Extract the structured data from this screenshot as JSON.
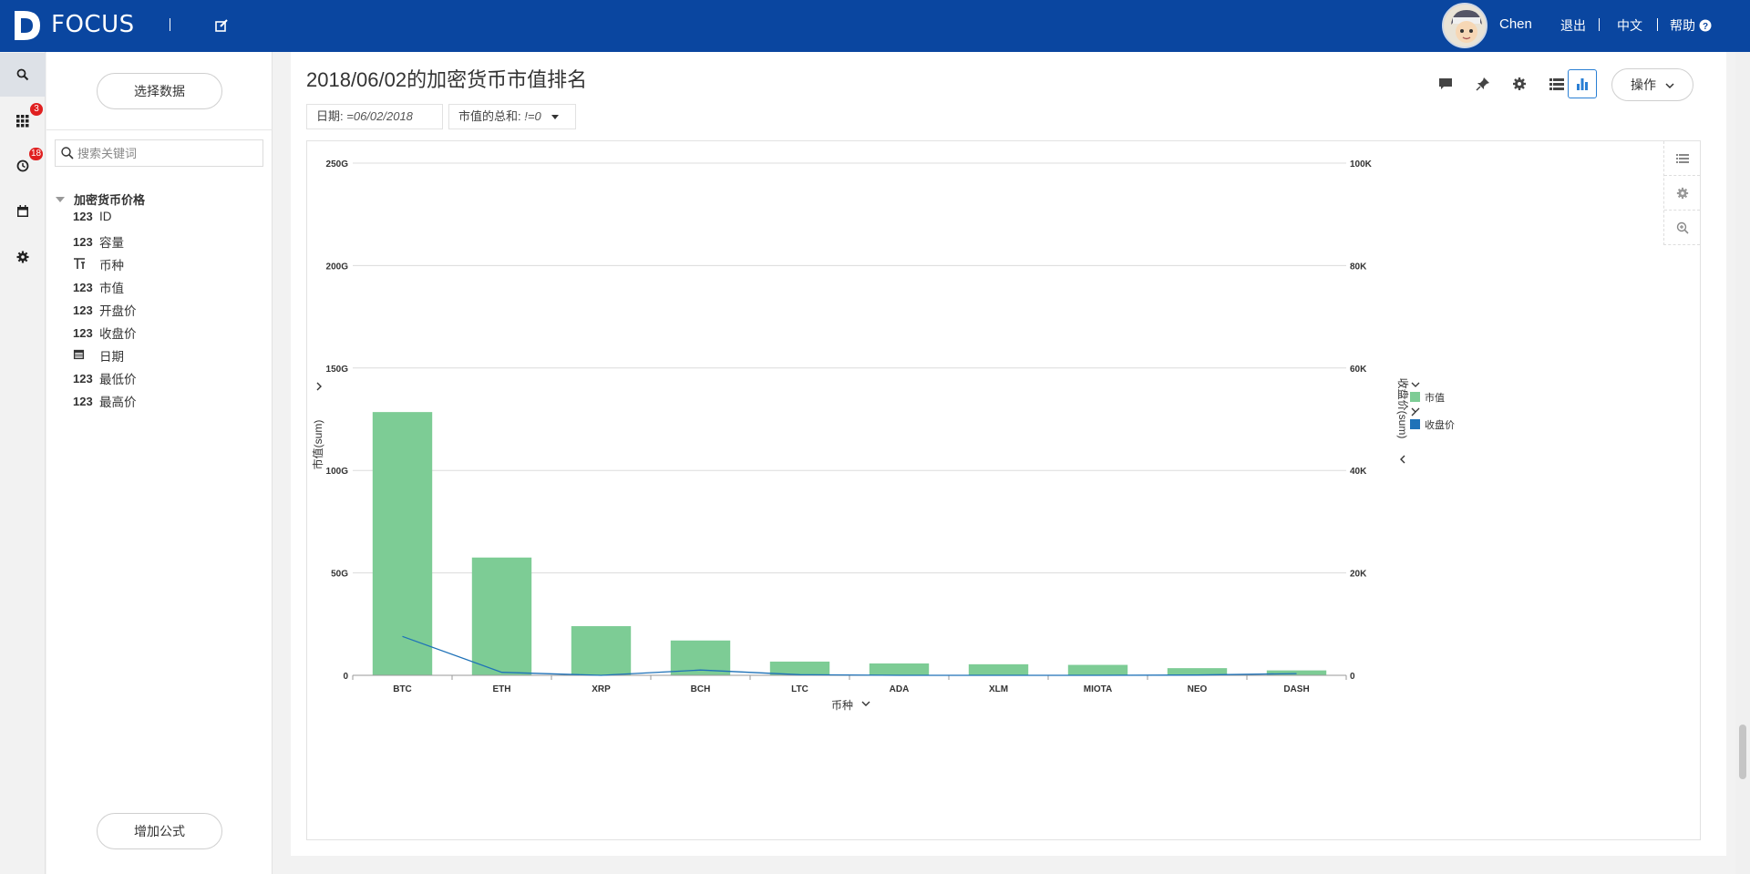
{
  "topbar": {
    "brand": "FOCUS",
    "user": "Chen",
    "logout": "退出",
    "language": "中文",
    "help": "帮助"
  },
  "iconbar": {
    "apps_badge": "3",
    "history_badge": "18"
  },
  "datapanel": {
    "select_data": "选择数据",
    "search_placeholder": "搜索关键词",
    "tree_root": "加密货币价格",
    "fields": [
      {
        "type": "123",
        "name": "ID"
      },
      {
        "type": "123",
        "name": "容量"
      },
      {
        "type": "text",
        "name": "币种"
      },
      {
        "type": "123",
        "name": "市值"
      },
      {
        "type": "123",
        "name": "开盘价"
      },
      {
        "type": "123",
        "name": "收盘价"
      },
      {
        "type": "date",
        "name": "日期"
      },
      {
        "type": "123",
        "name": "最低价"
      },
      {
        "type": "123",
        "name": "最高价"
      }
    ],
    "add_formula": "增加公式"
  },
  "main": {
    "title": "2018/06/02的加密货币市值排名",
    "filters": [
      {
        "label": "日期:",
        "value": "=06/02/2018"
      },
      {
        "label": "市值的总和:",
        "value": "!=0"
      }
    ],
    "operate": "操作"
  },
  "colors": {
    "bar": "#7dcc95",
    "line": "#1f72b8",
    "topbar": "#0a46a0"
  },
  "chart_data": {
    "type": "bar",
    "categories": [
      "BTC",
      "ETH",
      "XRP",
      "BCH",
      "LTC",
      "ADA",
      "XLM",
      "MIOTA",
      "NEO",
      "DASH"
    ],
    "series": [
      {
        "name": "市值",
        "axis": "left",
        "type": "bar",
        "values": [
          128.5,
          57.5,
          24.0,
          17.0,
          6.7,
          5.8,
          5.4,
          5.1,
          3.5,
          2.4
        ]
      },
      {
        "name": "收盘价",
        "axis": "right",
        "type": "line",
        "values": [
          7600,
          590,
          0.68,
          1030,
          123,
          0.22,
          0.29,
          1.8,
          49,
          330
        ]
      }
    ],
    "xlabel": "币种",
    "ylabel": "市值(sum)",
    "y2label": "收盘价(sum)",
    "ylim": [
      0,
      250
    ],
    "y2lim": [
      0,
      100000
    ],
    "yticks": [
      "0",
      "50G",
      "100G",
      "150G",
      "200G",
      "250G"
    ],
    "y2ticks": [
      "0",
      "20K",
      "40K",
      "60K",
      "80K",
      "100K"
    ],
    "grid": true,
    "legend_position": "right"
  }
}
